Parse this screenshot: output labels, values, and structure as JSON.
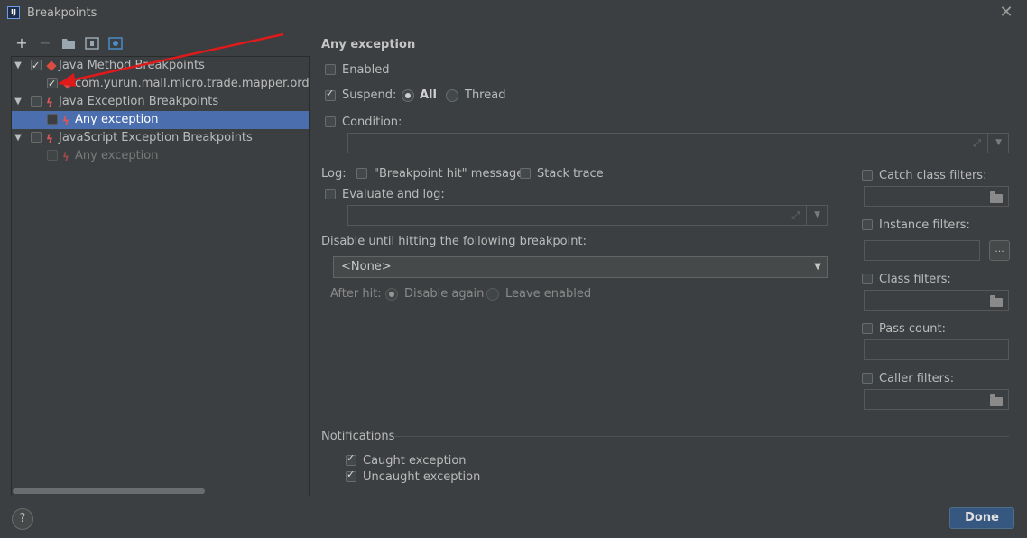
{
  "window": {
    "title": "Breakpoints",
    "icon_text": "IJ"
  },
  "toolbar": {
    "add_icon": "plus-icon",
    "remove_icon": "minus-icon",
    "group_package_icon": "folder-icon",
    "group_class_icon": "class-group-icon",
    "group_by_file_icon": "file-group-icon"
  },
  "tree": {
    "items": [
      {
        "label": "Java Method Breakpoints",
        "checked": true
      },
      {
        "label": "com.yurun.mall.micro.trade.mapper.order.Or",
        "checked": true
      },
      {
        "label": "Java Exception Breakpoints",
        "checked": false
      },
      {
        "label": "Any exception",
        "checked": false,
        "selected": true
      },
      {
        "label": "JavaScript Exception Breakpoints",
        "checked": false
      },
      {
        "label": "Any exception",
        "checked": false,
        "disabled": true
      }
    ]
  },
  "details": {
    "title": "Any exception",
    "enabled_label": "Enabled",
    "suspend_label": "Suspend:",
    "suspend_all": "All",
    "suspend_thread": "Thread",
    "condition_label": "Condition:",
    "log_label": "Log:",
    "log_message_label": "\"Breakpoint hit\" message",
    "stack_trace_label": "Stack trace",
    "evaluate_log_label": "Evaluate and log:",
    "disable_until_label": "Disable until hitting the following breakpoint:",
    "disable_until_value": "<None>",
    "after_hit_label": "After hit:",
    "disable_again_label": "Disable again",
    "leave_enabled_label": "Leave enabled"
  },
  "filters": {
    "catch_class": "Catch class filters:",
    "instance": "Instance filters:",
    "instance_button": "...",
    "class": "Class filters:",
    "pass_count": "Pass count:",
    "caller": "Caller filters:"
  },
  "notifications": {
    "title": "Notifications",
    "caught": "Caught exception",
    "uncaught": "Uncaught exception"
  },
  "footer": {
    "help": "?",
    "done": "Done"
  },
  "colors": {
    "background": "#3c3f41",
    "selection": "#4b6eaf",
    "done_button": "#365880",
    "breakpoint_red": "#dc4b3f",
    "annotation_arrow": "#e0191b"
  }
}
